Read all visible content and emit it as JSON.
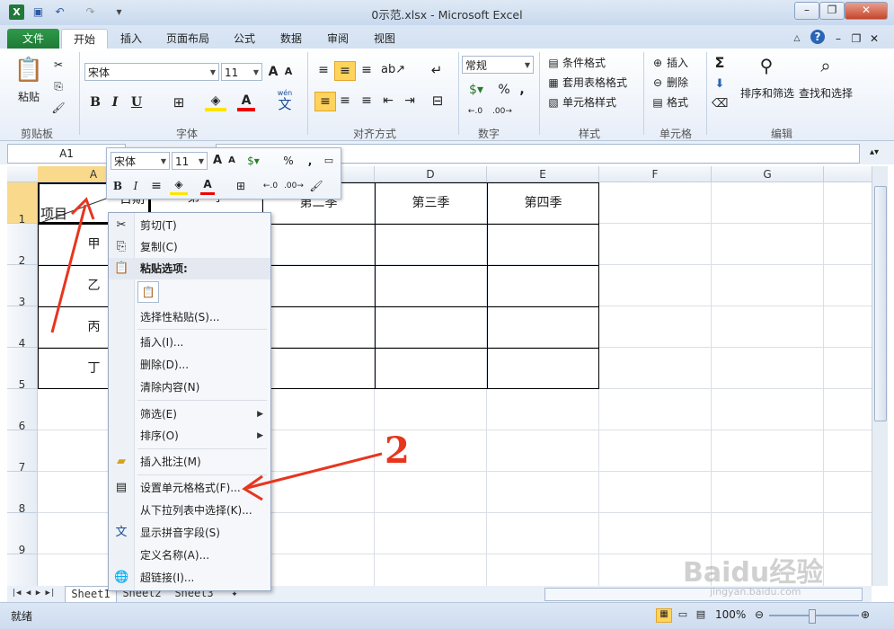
{
  "window": {
    "title": "0示范.xlsx - Microsoft Excel",
    "app_icon": "excel-icon",
    "controls": [
      "minimize-icon",
      "restore-icon",
      "close-icon"
    ]
  },
  "ribbon_tabs": [
    {
      "label": "文件"
    },
    {
      "label": "开始"
    },
    {
      "label": "插入"
    },
    {
      "label": "页面布局"
    },
    {
      "label": "公式"
    },
    {
      "label": "数据"
    },
    {
      "label": "审阅"
    },
    {
      "label": "视图"
    }
  ],
  "ribbon": {
    "clipboard": {
      "paste": "粘贴",
      "group": "剪贴板"
    },
    "font": {
      "name": "宋体",
      "size": "11",
      "group": "字体",
      "bold": "B",
      "italic": "I",
      "underline": "U",
      "grow": "A",
      "shrink": "A",
      "phonetic": "文",
      "phonetic_top": "wén"
    },
    "alignment": {
      "group": "对齐方式"
    },
    "number": {
      "format": "常规",
      "percent": "%",
      "comma": ",",
      "group": "数字"
    },
    "styles": {
      "cond_format": "条件格式",
      "table_format": "套用表格格式",
      "cell_styles": "单元格样式",
      "group": "样式"
    },
    "cells": {
      "insert": "插入",
      "delete": "删除",
      "format": "格式",
      "group": "单元格"
    },
    "editing": {
      "sum": "Σ",
      "sort_filter": "排序和筛选",
      "find_select": "查找和选择",
      "group": "编辑"
    }
  },
  "formula_bar": {
    "name_box": "A1"
  },
  "columns": [
    "A",
    "B",
    "C",
    "D",
    "E",
    "F",
    "G"
  ],
  "rows": [
    "1",
    "2",
    "3",
    "4",
    "5",
    "6",
    "7",
    "8",
    "9",
    "10"
  ],
  "cells": {
    "a1": "项目",
    "b1_partial": "日期",
    "c1": "第二季",
    "b1_header": "第一季",
    "d1": "第三季",
    "e1": "第四季",
    "a2": "甲",
    "a3": "乙",
    "a4": "丙",
    "a5": "丁"
  },
  "mini_toolbar": {
    "font": "宋体",
    "size": "11",
    "percent": "%",
    "comma": ","
  },
  "context_menu": [
    {
      "label": "剪切(T)",
      "icon": "scissors-icon"
    },
    {
      "label": "复制(C)",
      "icon": "copy-icon"
    },
    {
      "label": "粘贴选项:",
      "icon": "paste-icon"
    },
    {
      "label": "选择性粘贴(S)..."
    },
    {
      "label": "插入(I)..."
    },
    {
      "label": "删除(D)..."
    },
    {
      "label": "清除内容(N)"
    },
    {
      "label": "筛选(E)"
    },
    {
      "label": "排序(O)"
    },
    {
      "label": "插入批注(M)",
      "icon": "comment-icon"
    },
    {
      "label": "设置单元格格式(F)...",
      "icon": "format-cells-icon"
    },
    {
      "label": "从下拉列表中选择(K)..."
    },
    {
      "label": "显示拼音字段(S)",
      "icon": "phonetic-icon"
    },
    {
      "label": "定义名称(A)..."
    },
    {
      "label": "超链接(I)...",
      "icon": "hyperlink-icon"
    }
  ],
  "sheets": [
    "Sheet1",
    "Sheet2",
    "Sheet3"
  ],
  "status": {
    "ready": "就绪",
    "zoom": "100%"
  },
  "annotation": {
    "label": "2",
    "color": "#e8351e"
  },
  "watermark": {
    "brand": "Baidu经验",
    "url": "jingyan.baidu.com"
  }
}
